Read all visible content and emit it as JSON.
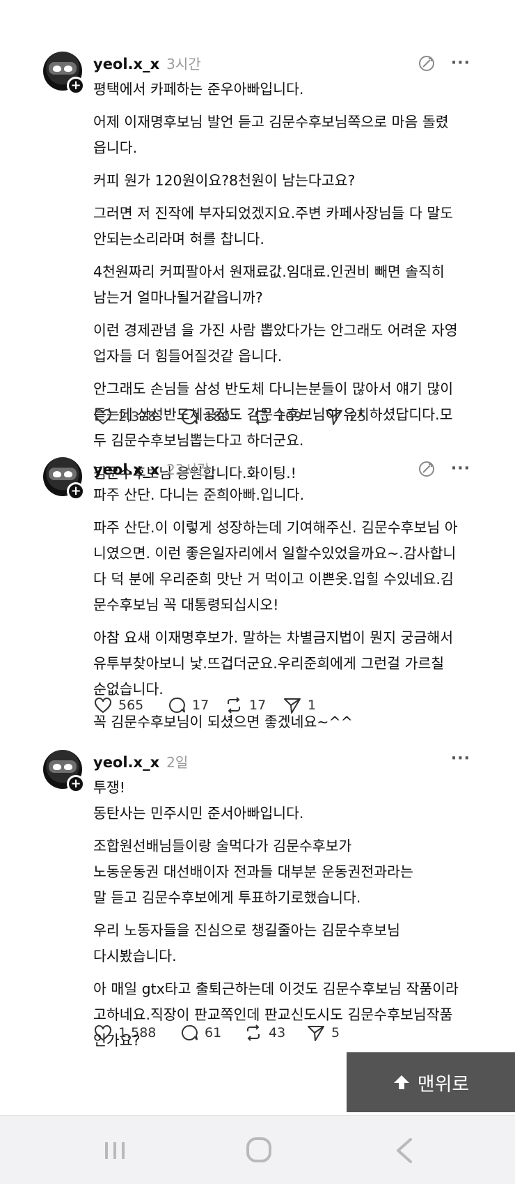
{
  "posts": [
    {
      "username": "yeol.x_x",
      "time": "3시간",
      "lines": [
        "평택에서 카페하는 준우아빠입니다.",
        "어제 이재명후보님 발언 듣고 김문수후보님쪽으로 마음 돌렸",
        "읍니다.",
        "커피 원가 120원이요?8천원이 남는다고요?",
        "그러면 저 진작에 부자되었겠지요.주변 카페사장님들 다 말도",
        "안되는소리라며 혀를 찹니다.",
        "4천원짜리 커피팔아서 원재료값.임대료.인권비 빼면 솔직히",
        "남는거 얼마나될거같읍니까?",
        "이런 경제관념 을 가진 사람 뽑았다가는 안그래도 어려운 자영",
        "업자들 더 힘들어질것같 읍니다.",
        "안그래도 손님들 삼성 반도체 다니는분들이 많아서 얘기 많이",
        "듣는데 삼성반도체공장도 김문수후보님이 유치하셨답디다.모",
        "두 김문수후보님뽑는다고 하더군요.",
        "김문수후보님 응원합니다.화이팅.!"
      ],
      "likes": "2,378",
      "replies": "180",
      "reposts": "109",
      "shares": "25"
    },
    {
      "username": "yeol.x_x",
      "time": "23시간",
      "lines": [
        "파주 산단. 다니는 준희아빠.입니다.",
        "파주 산단.이 이렇게 성장하는데 기여해주신. 김문수후보님 아",
        "니였으면. 이런 좋은일자리에서 일할수있었을까요~.감사합니",
        "다 덕 분에 우리준희 맛난 거 먹이고 이쁜옷.입힐 수있네요.김",
        "문수후보님 꼭 대통령되십시오!",
        "아참 요새 이재명후보가. 말하는 차별금지법이 뭔지 궁금해서",
        "유투부찾아보니 낯.뜨겁더군요.우리준희에게 그런걸 가르칠",
        "순없습니다.",
        "꼭 김문수후보님이 되셨으면 좋겠네요~^^"
      ],
      "likes": "565",
      "replies": "17",
      "reposts": "17",
      "shares": "1"
    },
    {
      "username": "yeol.x_x",
      "time": "2일",
      "lines": [
        "투쟁!",
        "동탄사는 민주시민 준서아빠입니다.",
        "조합원선배님들이랑 술먹다가 김문수후보가",
        "노동운동권 대선배이자 전과들 대부분 운동권전과라는",
        "말 듣고 김문수후보에게 투표하기로했습니다.",
        "우리 노동자들을 진심으로 챙길줄아는 김문수후보님",
        "다시봤습니다.",
        "아 매일 gtx타고 출퇴근하는데 이것도 김문수후보님 작품이라",
        "고하네요.직장이 판교쪽인데 판교신도시도 김문수후보님작품",
        "인가요?"
      ],
      "likes": "1,588",
      "replies": "61",
      "reposts": "43",
      "shares": "5"
    }
  ],
  "scroll_top_button": {
    "label": "맨위로"
  },
  "icons": {
    "like": "heart-icon",
    "reply": "comment-icon",
    "repost": "repost-icon",
    "share": "send-icon",
    "more": "more-icon",
    "translate": "ai-translate-icon"
  }
}
